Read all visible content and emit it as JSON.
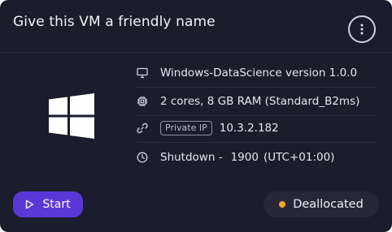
{
  "card": {
    "title": "Give this VM a friendly name",
    "more_icon": "kebab-vertical-icon",
    "os_logo": "windows-logo",
    "details": [
      {
        "icon": "monitor-icon",
        "text": "Windows-DataScience version 1.0.0"
      },
      {
        "icon": "cpu-chip-icon",
        "text": "2 cores, 8 GB RAM (Standard_B2ms)"
      },
      {
        "icon": "link-icon",
        "badge": "Private IP",
        "text": "10.3.2.182"
      },
      {
        "icon": "clock-icon",
        "prefix": "Shutdown -",
        "time": "1900",
        "timezone": "(UTC+01:00)"
      }
    ],
    "start_button": {
      "label": "Start",
      "icon": "play-outline-icon"
    },
    "status": {
      "label": "Deallocated",
      "dot_color": "#f5a524"
    }
  },
  "colors": {
    "card_bg": "#1b1d2c",
    "accent": "#5b37d8",
    "pill_bg": "#262839",
    "divider": "#2c2f42"
  }
}
